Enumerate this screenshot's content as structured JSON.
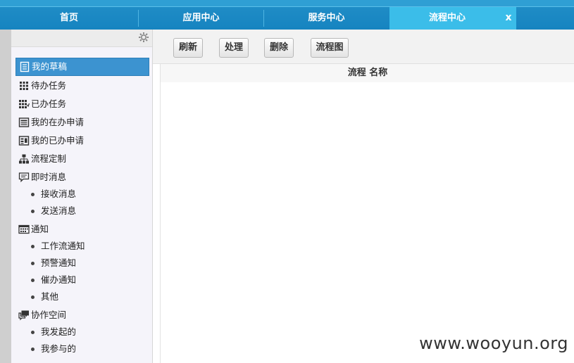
{
  "tabs": [
    {
      "label": "首页"
    },
    {
      "label": "应用中心"
    },
    {
      "label": "服务中心"
    },
    {
      "label": "流程中心",
      "active": true
    }
  ],
  "tab_close": "x",
  "sidebar": {
    "menu": [
      {
        "label": "我的草稿",
        "icon": "draft-icon",
        "active": true
      },
      {
        "label": "待办任务",
        "icon": "grid-icon"
      },
      {
        "label": "已办任务",
        "icon": "grid-check-icon"
      },
      {
        "label": "我的在办申请",
        "icon": "form-icon"
      },
      {
        "label": "我的已办申请",
        "icon": "form-done-icon"
      },
      {
        "label": "流程定制",
        "icon": "org-chart-icon"
      },
      {
        "label": "即时消息",
        "icon": "chat-icon",
        "children": [
          "接收消息",
          "发送消息"
        ]
      },
      {
        "label": "通知",
        "icon": "calendar-icon",
        "children": [
          "工作流通知",
          "预警通知",
          "催办通知",
          "其他"
        ]
      },
      {
        "label": "协作空间",
        "icon": "comments-icon",
        "children": [
          "我发起的",
          "我参与的"
        ]
      }
    ]
  },
  "toolbar": {
    "buttons": [
      "刷新",
      "处理",
      "删除",
      "流程图"
    ]
  },
  "grid": {
    "columns": [
      "流程 名称"
    ]
  },
  "watermark": "www.wooyun.org",
  "colors": {
    "tabbar": "#1684c0",
    "active_tab": "#3bbde9",
    "active_menu": "#3c93d0"
  }
}
